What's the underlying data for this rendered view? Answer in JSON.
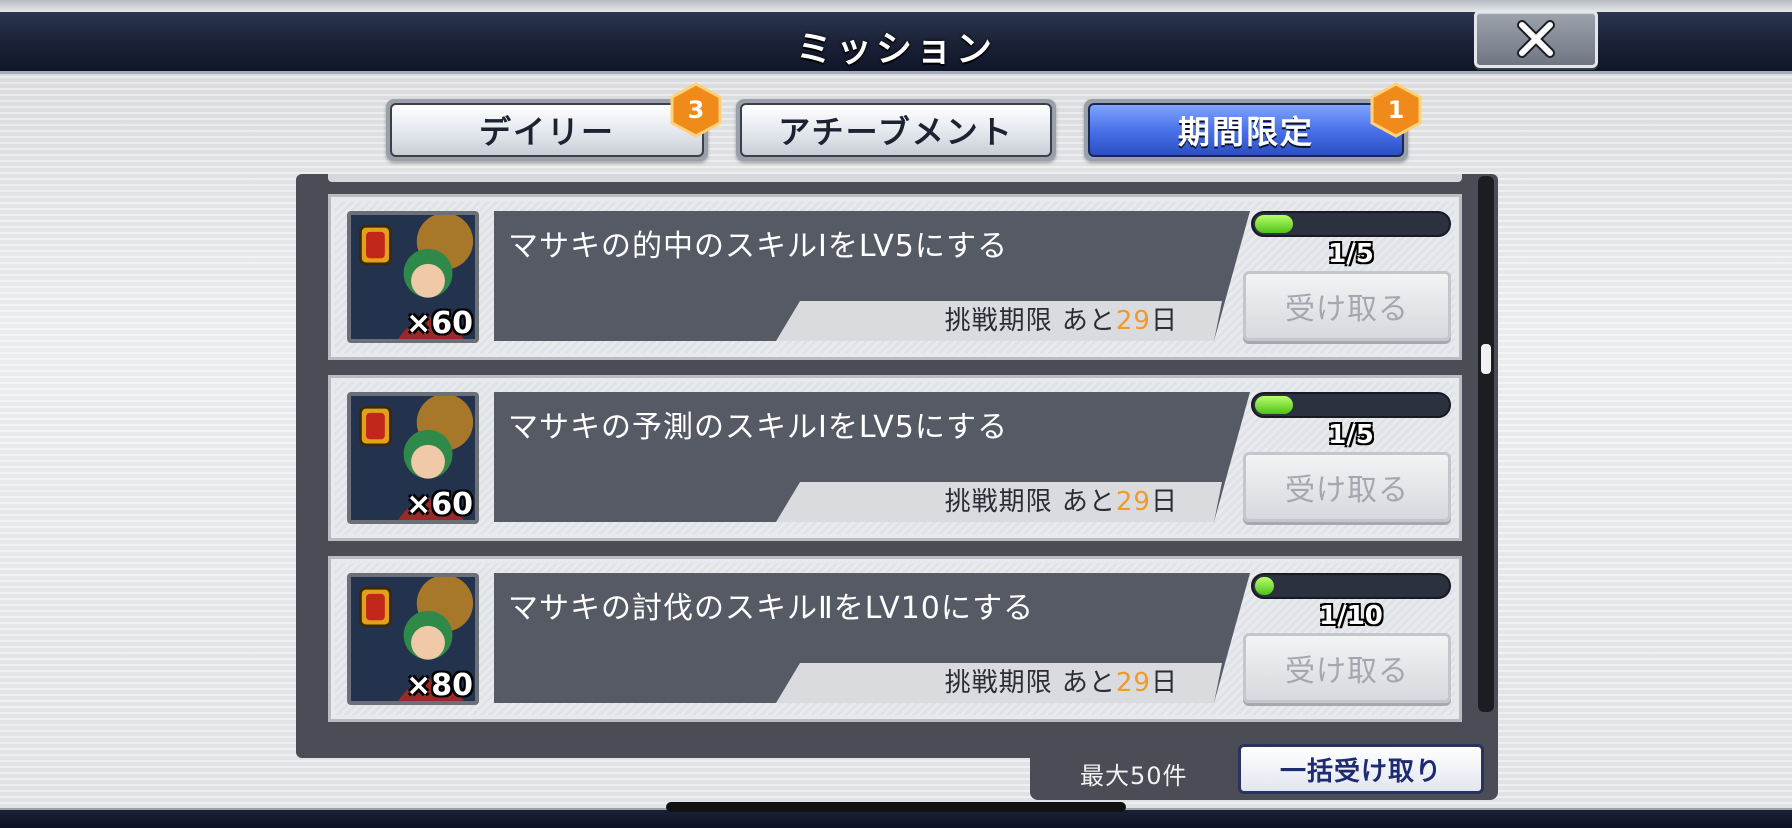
{
  "header": {
    "title": "ミッション",
    "close_icon": "close-icon"
  },
  "tabs": [
    {
      "label": "デイリー",
      "badge": "3",
      "active": false
    },
    {
      "label": "アチーブメント",
      "badge": "",
      "active": false
    },
    {
      "label": "期間限定",
      "badge": "1",
      "active": true
    }
  ],
  "missions": [
    {
      "reward_icon": "character-reward-icon",
      "reward_qty": "×60",
      "title": "マサキの的中のスキルⅠをLV5にする",
      "deadline_prefix": "挑戦期限 あと",
      "deadline_days": "29",
      "deadline_suffix": "日",
      "progress_label": "1/5",
      "progress_value": 0.2,
      "claim_label": "受け取る"
    },
    {
      "reward_icon": "character-reward-icon",
      "reward_qty": "×60",
      "title": "マサキの予測のスキルⅠをLV5にする",
      "deadline_prefix": "挑戦期限 あと",
      "deadline_days": "29",
      "deadline_suffix": "日",
      "progress_label": "1/5",
      "progress_value": 0.2,
      "claim_label": "受け取る"
    },
    {
      "reward_icon": "character-reward-icon",
      "reward_qty": "×80",
      "title": "マサキの討伐のスキルⅡをLV10にする",
      "deadline_prefix": "挑戦期限 あと",
      "deadline_days": "29",
      "deadline_suffix": "日",
      "progress_label": "1/10",
      "progress_value": 0.1,
      "claim_label": "受け取る"
    }
  ],
  "footer": {
    "max_label": "最大50件",
    "bulk_claim_label": "一括受け取り"
  },
  "colors": {
    "accent_orange": "#f09a2a",
    "active_tab": "#4a72ea",
    "progress_green": "#4fc21a"
  }
}
